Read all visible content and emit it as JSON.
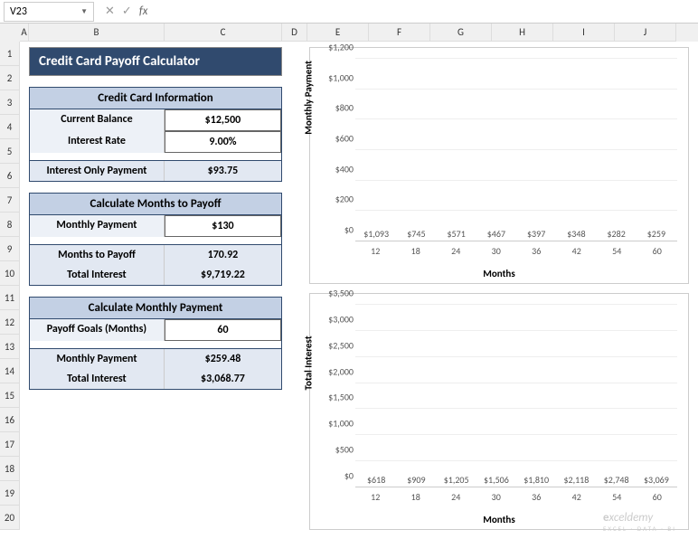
{
  "nameBox": "V23",
  "title": "Credit Card Payoff Calculator",
  "sections": {
    "info": {
      "header": "Credit Card Information",
      "rows": [
        {
          "label": "Current Balance",
          "value": "$12,500"
        },
        {
          "label": "Interest Rate",
          "value": "9.00%"
        }
      ],
      "result": {
        "label": "Interest Only Payment",
        "value": "$93.75"
      }
    },
    "months": {
      "header": "Calculate Months to Payoff",
      "input": {
        "label": "Monthly Payment",
        "value": "$130"
      },
      "results": [
        {
          "label": "Months to Payoff",
          "value": "170.92"
        },
        {
          "label": "Total Interest",
          "value": "$9,719.22"
        }
      ]
    },
    "payment": {
      "header": "Calculate Monthly Payment",
      "input": {
        "label": "Payoff Goals (Months)",
        "value": "60"
      },
      "results": [
        {
          "label": "Monthly Payment",
          "value": "$259.48"
        },
        {
          "label": "Total Interest",
          "value": "$3,068.77"
        }
      ]
    }
  },
  "cols": [
    "A",
    "B",
    "C",
    "D",
    "E",
    "F",
    "G",
    "H",
    "I",
    "J"
  ],
  "rows": [
    "1",
    "2",
    "3",
    "4",
    "5",
    "6",
    "7",
    "8",
    "9",
    "10",
    "11",
    "12",
    "13",
    "14",
    "15",
    "16",
    "17",
    "18",
    "19",
    "20"
  ],
  "chart_data": [
    {
      "type": "bar",
      "title": "",
      "ylabel": "Monthly Payment",
      "xlabel": "Months",
      "categories": [
        "12",
        "18",
        "24",
        "30",
        "36",
        "42",
        "54",
        "60"
      ],
      "values": [
        1093,
        745,
        571,
        467,
        397,
        348,
        282,
        259
      ],
      "labels": [
        "$1,093",
        "$745",
        "$571",
        "$467",
        "$397",
        "$348",
        "$282",
        "$259"
      ],
      "yticks": [
        "$0",
        "$200",
        "$400",
        "$600",
        "$800",
        "$1,000",
        "$1,200"
      ],
      "ylim": [
        0,
        1200
      ],
      "color": "#2c3e50"
    },
    {
      "type": "bar",
      "title": "",
      "ylabel": "Total Interest",
      "xlabel": "Months",
      "categories": [
        "12",
        "18",
        "24",
        "30",
        "36",
        "42",
        "54",
        "60"
      ],
      "values": [
        618,
        909,
        1205,
        1506,
        1810,
        2118,
        2748,
        3069
      ],
      "labels": [
        "$618",
        "$909",
        "$1,205",
        "$1,506",
        "$1,810",
        "$2,118",
        "$2,748",
        "$3,069"
      ],
      "yticks": [
        "$0",
        "$500",
        "$1,000",
        "$1,500",
        "$2,000",
        "$2,500",
        "$3,000",
        "$3,500"
      ],
      "ylim": [
        0,
        3500
      ],
      "color": "#ed8b3a"
    }
  ],
  "watermark": {
    "brand": "exceldemy",
    "e": "e",
    "tag": "EXCEL · DATA · BI"
  }
}
